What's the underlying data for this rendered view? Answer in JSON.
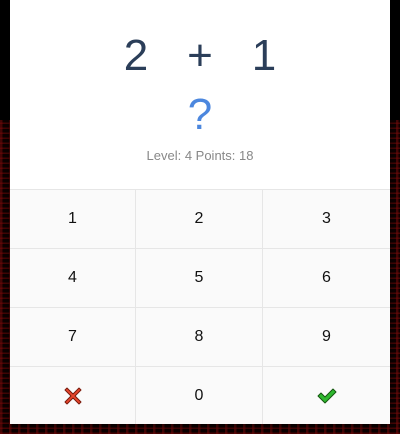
{
  "problem": {
    "left_operand": "2",
    "operator": "+",
    "right_operand": "1"
  },
  "answer": {
    "placeholder": "?"
  },
  "status": {
    "text": "Level: 4 Points: 18"
  },
  "keypad": {
    "keys": [
      "1",
      "2",
      "3",
      "4",
      "5",
      "6",
      "7",
      "8",
      "9"
    ],
    "zero": "0",
    "clear_icon": "x-mark-icon",
    "submit_icon": "check-mark-icon"
  },
  "colors": {
    "operand": "#2b3e59",
    "answer": "#4c87de",
    "clear": "#e8452c",
    "submit": "#2fb82f"
  }
}
